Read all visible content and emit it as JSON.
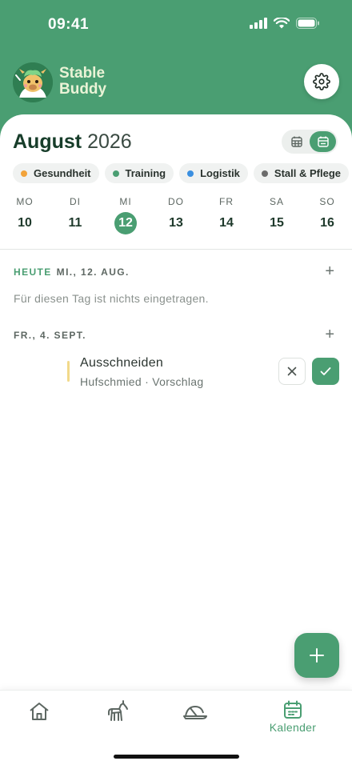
{
  "status_bar": {
    "time": "09:41"
  },
  "header": {
    "brand_line1": "Stable",
    "brand_line2": "Buddy"
  },
  "calendar": {
    "month": "August",
    "year": "2026",
    "categories": [
      {
        "label": "Gesundheit",
        "color": "#f2a33a"
      },
      {
        "label": "Training",
        "color": "#4a9e72"
      },
      {
        "label": "Logistik",
        "color": "#3a8fe0"
      },
      {
        "label": "Stall & Pflege",
        "color": "#6b6b6b"
      }
    ],
    "week": [
      {
        "name": "MO",
        "date": "10",
        "selected": false
      },
      {
        "name": "DI",
        "date": "11",
        "selected": false
      },
      {
        "name": "MI",
        "date": "12",
        "selected": true
      },
      {
        "name": "DO",
        "date": "13",
        "selected": false
      },
      {
        "name": "FR",
        "date": "14",
        "selected": false
      },
      {
        "name": "SA",
        "date": "15",
        "selected": false
      },
      {
        "name": "SO",
        "date": "16",
        "selected": false
      }
    ]
  },
  "agenda": {
    "today_label": "HEUTE",
    "today_date": "MI., 12. AUG.",
    "empty_text": "Für diesen Tag ist nichts eingetragen.",
    "next_date": "FR., 4. SEPT.",
    "event": {
      "title": "Ausschneiden",
      "subtitle": "Hufschmied · Vorschlag"
    }
  },
  "tabbar": {
    "active_label": "Kalender"
  },
  "colors": {
    "primary": "#4a9e72",
    "header_bg": "#4a9e72",
    "event_bar": "#f2d98a"
  }
}
